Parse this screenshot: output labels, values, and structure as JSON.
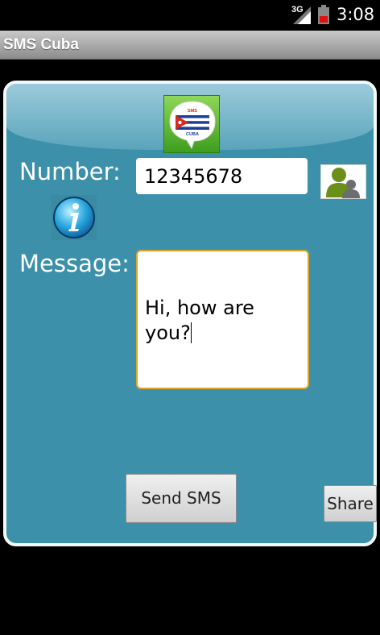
{
  "status_bar": {
    "network": "3G",
    "time": "3:08"
  },
  "app": {
    "title": "SMS Cuba"
  },
  "logo": {
    "top_text": "SMS",
    "bottom_text": "CUBA"
  },
  "form": {
    "number_label": "Number:",
    "number_value": "12345678",
    "message_label": "Message:",
    "message_value": "Hi, how are you?"
  },
  "buttons": {
    "send_label": "Send SMS",
    "share_label": "Share"
  },
  "colors": {
    "panel": "#3c90aa",
    "field_focus_border": "#e1a32c",
    "logo_green": "#5cb82e",
    "flag_blue": "#1c3e94",
    "flag_red": "#d52b1e"
  },
  "icons": {
    "contact": "contact-person-icon",
    "info": "info-icon"
  }
}
